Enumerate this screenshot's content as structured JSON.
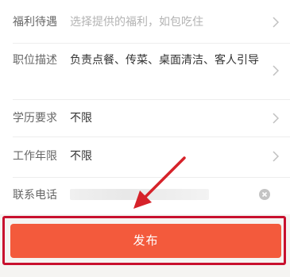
{
  "form": {
    "benefits": {
      "label": "福利待遇",
      "placeholder": "选择提供的福利，如包吃住"
    },
    "description": {
      "label": "职位描述",
      "value": "负责点餐、传菜、桌面清洁、客人引导"
    },
    "education": {
      "label": "学历要求",
      "value": "不限"
    },
    "experience": {
      "label": "工作年限",
      "value": "不限"
    },
    "phone": {
      "label": "联系电话"
    }
  },
  "publish": {
    "label": "发布"
  },
  "colors": {
    "accent": "#f35a3c",
    "highlight_frame": "#c8102e",
    "annotation_arrow": "#d6222a"
  }
}
